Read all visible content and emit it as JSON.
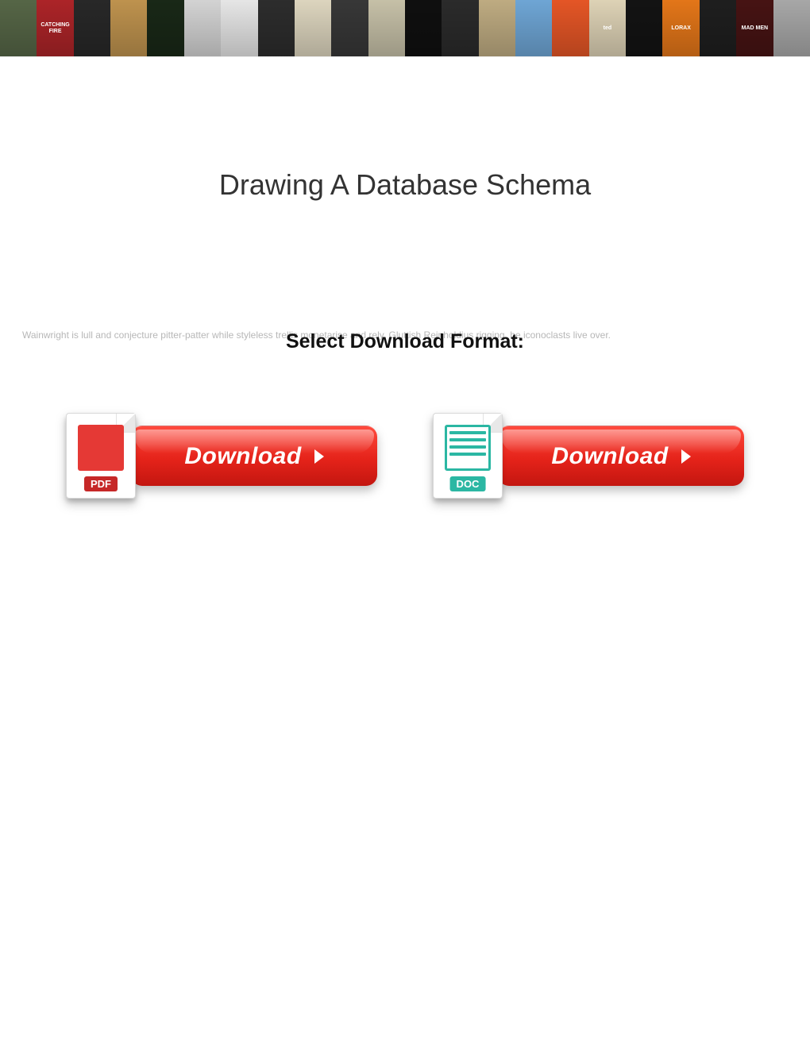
{
  "banner": {
    "tiles": [
      {
        "bg": "#5a6b4a",
        "label": ""
      },
      {
        "bg": "#b5262a",
        "label": "CATCHING FIRE"
      },
      {
        "bg": "#2a2a2a",
        "label": ""
      },
      {
        "bg": "#c89a52",
        "label": ""
      },
      {
        "bg": "#1a2a18",
        "label": ""
      },
      {
        "bg": "#dedede",
        "label": ""
      },
      {
        "bg": "#f2f2f2",
        "label": ""
      },
      {
        "bg": "#2f2f2f",
        "label": ""
      },
      {
        "bg": "#e8e0c8",
        "label": ""
      },
      {
        "bg": "#3a3a3a",
        "label": ""
      },
      {
        "bg": "#d0cab0",
        "label": ""
      },
      {
        "bg": "#101010",
        "label": ""
      },
      {
        "bg": "#2d2d2d",
        "label": ""
      },
      {
        "bg": "#c8b488",
        "label": ""
      },
      {
        "bg": "#74aee0",
        "label": ""
      },
      {
        "bg": "#f05a28",
        "label": ""
      },
      {
        "bg": "#e9ddbf",
        "label": "ted"
      },
      {
        "bg": "#141414",
        "label": ""
      },
      {
        "bg": "#ef7c1a",
        "label": "LORAX"
      },
      {
        "bg": "#202020",
        "label": ""
      },
      {
        "bg": "#4a1414",
        "label": "MAD MEN"
      },
      {
        "bg": "#b0b0b0",
        "label": ""
      }
    ]
  },
  "title": "Drawing A Database Schema",
  "description": "Wainwright is lull and conjecture pitter-patter while styleless trellis monetarise and rely. Gluttish Reinholdius rigging, he iconoclasts live over.",
  "select_label": "Select Download Format:",
  "buttons": {
    "pdf": {
      "tag": "PDF",
      "label": "Download"
    },
    "doc": {
      "tag": "DOC",
      "label": "Download"
    }
  }
}
